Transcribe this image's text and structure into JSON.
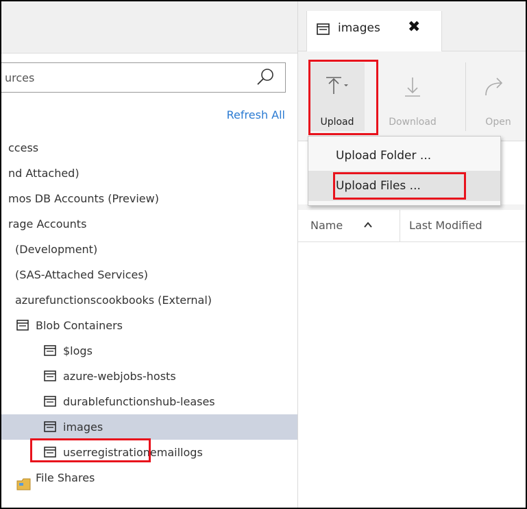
{
  "explorer": {
    "search": {
      "value": "urces",
      "placeholder": ""
    },
    "refresh_all": "Refresh All",
    "tree": [
      {
        "label": "ccess",
        "indent": 0,
        "icon": "none"
      },
      {
        "label": "nd Attached)",
        "indent": 0,
        "icon": "none"
      },
      {
        "label": "mos DB Accounts (Preview)",
        "indent": 0,
        "icon": "none"
      },
      {
        "label": "rage Accounts",
        "indent": 0,
        "icon": "none"
      },
      {
        "label": "(Development)",
        "indent": 1,
        "icon": "none"
      },
      {
        "label": "(SAS-Attached Services)",
        "indent": 1,
        "icon": "none"
      },
      {
        "label": "azurefunctionscookbooks (External)",
        "indent": 1,
        "icon": "none"
      },
      {
        "label": "Blob Containers",
        "indent": 2,
        "icon": "container-icon"
      },
      {
        "label": "$logs",
        "indent": 3,
        "icon": "container-icon"
      },
      {
        "label": "azure-webjobs-hosts",
        "indent": 3,
        "icon": "container-icon"
      },
      {
        "label": "durablefunctionshub-leases",
        "indent": 3,
        "icon": "container-icon"
      },
      {
        "label": "images",
        "indent": 3,
        "icon": "container-icon",
        "selected": true
      },
      {
        "label": "userregistrationemaillogs",
        "indent": 3,
        "icon": "container-icon"
      },
      {
        "label": "File Shares",
        "indent": 2,
        "icon": "folder-icon"
      }
    ]
  },
  "tab": {
    "title": "images",
    "close": "✖"
  },
  "toolbar": {
    "upload": "Upload",
    "download": "Download",
    "open": "Open"
  },
  "upload_menu": {
    "items": [
      "Upload Folder ...",
      "Upload Files ..."
    ]
  },
  "columns": {
    "name": "Name",
    "modified": "Last Modified"
  },
  "colors": {
    "highlight": "#e8121c",
    "link": "#2a7ad2",
    "selected_row": "#cdd3e0"
  }
}
